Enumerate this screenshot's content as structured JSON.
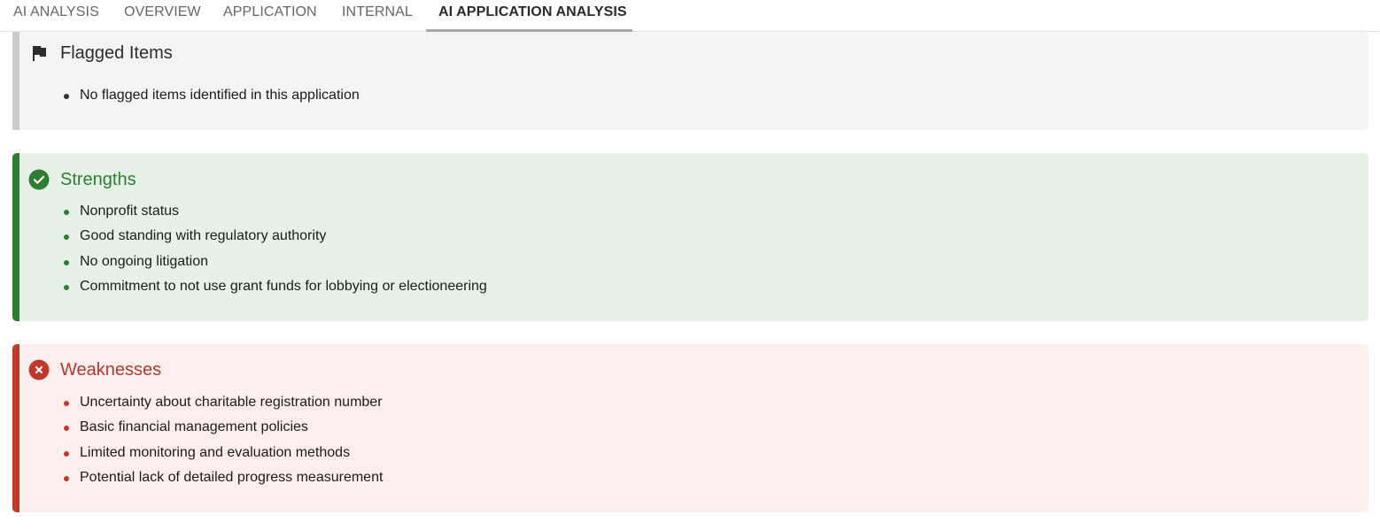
{
  "tabs": [
    {
      "label": "AI ANALYSIS",
      "active": false
    },
    {
      "label": "OVERVIEW",
      "active": false
    },
    {
      "label": "APPLICATION",
      "active": false
    },
    {
      "label": "INTERNAL",
      "active": false
    },
    {
      "label": "AI APPLICATION ANALYSIS",
      "active": true
    }
  ],
  "flagged": {
    "title": "Flagged Items",
    "icon": "flag-icon",
    "color": "#cccccc",
    "items": [
      "No flagged items identified in this application"
    ]
  },
  "strengths": {
    "title": "Strengths",
    "icon": "check-circle-icon",
    "color": "#2e7d32",
    "items": [
      "Nonprofit status",
      "Good standing with regulatory authority",
      "No ongoing litigation",
      "Commitment to not use grant funds for lobbying or electioneering"
    ]
  },
  "weaknesses": {
    "title": "Weaknesses",
    "icon": "x-circle-icon",
    "color": "#c0392b",
    "items": [
      "Uncertainty about charitable registration number",
      "Basic financial management policies",
      "Limited monitoring and evaluation methods",
      "Potential lack of detailed progress measurement"
    ]
  }
}
